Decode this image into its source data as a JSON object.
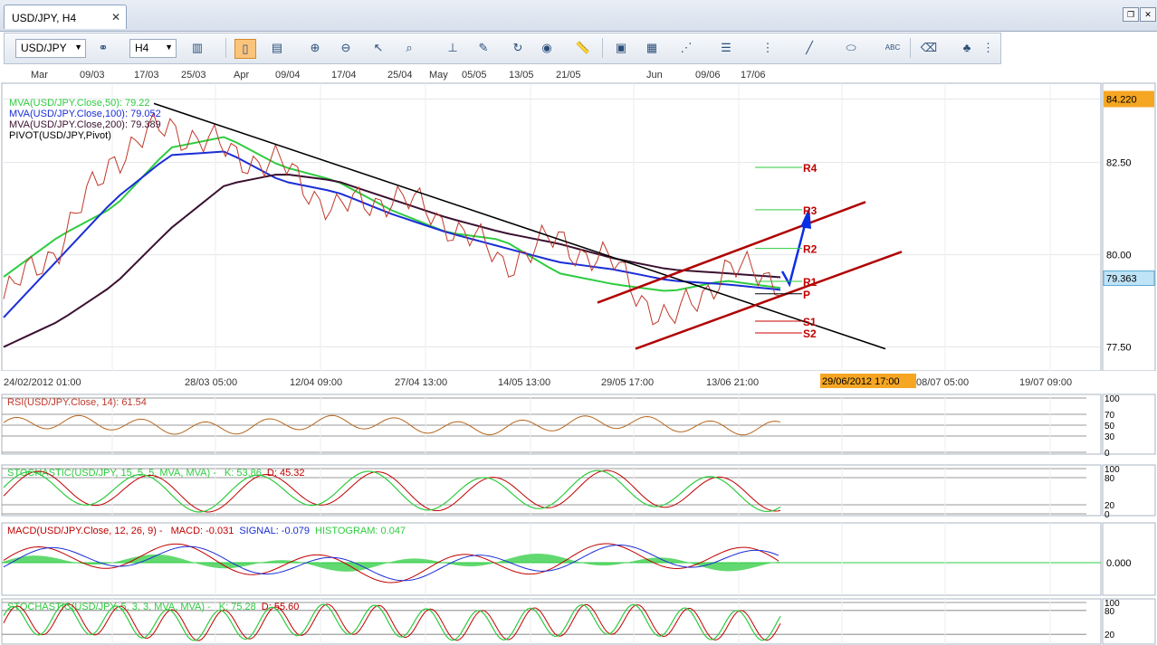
{
  "tab": {
    "title": "USD/JPY, H4",
    "close": "✕"
  },
  "window_controls": [
    "restore-icon",
    "close-icon"
  ],
  "toolbar": {
    "symbol": "USD/JPY",
    "timeframe": "H4",
    "icons": [
      "link-icon",
      "bar-chart-icon",
      "candlestick-icon",
      "line-chart-icon",
      "zoom-in-icon",
      "zoom-out-icon",
      "cursor-icon",
      "zoom-range-icon",
      "crosshair-icon",
      "pencil-chart-icon",
      "refresh-icon",
      "globe-icon",
      "ruler-icon",
      "screenshot-icon",
      "template-icon",
      "trendlines-icon",
      "horizontal-lines-icon",
      "fan-icon",
      "line-draw-icon",
      "ellipse-icon",
      "text-abc-icon",
      "eraser-icon",
      "objects-tree-icon",
      "more-icon"
    ]
  },
  "chart_data": [
    {
      "type": "line",
      "title": "USD/JPY, H4",
      "date_marks": [
        "Mar",
        "09/03",
        "17/03",
        "25/03",
        "Apr",
        "09/04",
        "17/04",
        "25/04",
        "May",
        "05/05",
        "13/05",
        "21/05",
        "Jun",
        "09/06",
        "17/06"
      ],
      "x_ticks": [
        "24/02/2012 01:00",
        "28/03 05:00",
        "12/04 09:00",
        "27/04 13:00",
        "14/05 13:00",
        "29/05 17:00",
        "13/06 21:00",
        "08/07 05:00",
        "19/07 09:00"
      ],
      "cursor_label": "29/06/2012 17:00",
      "y_ticks": [
        84.22,
        82.5,
        80.0,
        77.5
      ],
      "y_tick_labels": [
        "84.220",
        "82.50",
        "80.00",
        "77.50"
      ],
      "ylim": [
        76.9,
        84.6
      ],
      "price_label": "79.363",
      "legend": [
        {
          "text": "MVA(USD/JPY.Close,50): 79.22",
          "color": "#2ecc40"
        },
        {
          "text": "MVA(USD/JPY.Close,100): 79.052",
          "color": "#1a2ed6"
        },
        {
          "text": "MVA(USD/JPY.Close,200): 79.389",
          "color": "#3a1030"
        },
        {
          "text": "PIVOT(USD/JPY,Pivot)",
          "color": "#000000"
        }
      ],
      "pivots": [
        {
          "name": "R4",
          "value": 82.37
        },
        {
          "name": "R3",
          "value": 81.22
        },
        {
          "name": "R2",
          "value": 80.17
        },
        {
          "name": "R1",
          "value": 79.28
        },
        {
          "name": "P",
          "value": 78.94
        },
        {
          "name": "S1",
          "value": 78.2
        },
        {
          "name": "S2",
          "value": 77.88
        }
      ],
      "series": [
        {
          "name": "MVA(USD/JPY.Close,50)",
          "values": [
            79.4,
            80.5,
            81.3,
            82.9,
            83.2,
            82.4,
            82.0,
            81.2,
            80.6,
            80.4,
            79.5,
            79.2,
            79.0,
            79.3,
            79.1
          ]
        },
        {
          "name": "MVA(USD/JPY.Close,100)",
          "values": [
            78.3,
            79.9,
            81.5,
            82.7,
            82.8,
            82.0,
            81.7,
            81.1,
            80.6,
            80.2,
            79.8,
            79.6,
            79.3,
            79.2,
            79.05
          ]
        },
        {
          "name": "MVA(USD/JPY.Close,200)",
          "values": [
            77.5,
            78.2,
            79.2,
            80.7,
            81.9,
            82.2,
            82.0,
            81.5,
            81.0,
            80.6,
            80.3,
            79.9,
            79.6,
            79.5,
            79.39
          ]
        },
        {
          "name": "close",
          "values": [
            78.8,
            80.3,
            82.7,
            83.5,
            82.8,
            82.4,
            81.2,
            81.6,
            80.9,
            79.8,
            80.4,
            79.7,
            78.1,
            79.6,
            79.36
          ]
        }
      ]
    },
    {
      "type": "line",
      "title": "RSI(USD/JPY.Close, 14): 61.54",
      "y_tick_labels": [
        "100",
        "70",
        "50",
        "30",
        "0"
      ],
      "ylim": [
        0,
        100
      ]
    },
    {
      "type": "line",
      "title_parts": [
        "STOCHASTIC(USD/JPY, 15, 5, 5, MVA, MVA) - ",
        "K: 53.86",
        "D: 45.32"
      ],
      "y_tick_labels": [
        "100",
        "80",
        "20",
        "0"
      ],
      "ylim": [
        0,
        100
      ]
    },
    {
      "type": "bar",
      "title_parts": [
        "MACD(USD/JPY.Close, 12, 26, 9) - ",
        "MACD: -0.031",
        "SIGNAL: -0.079",
        "HISTOGRAM: 0.047"
      ],
      "y_tick_labels": [
        "0.000"
      ]
    },
    {
      "type": "line",
      "title_parts": [
        "STOCHASTIC(USD/JPY, 5, 3, 3, MVA, MVA) - ",
        "K: 75.28",
        "D: 55.60"
      ],
      "y_tick_labels": [
        "100",
        "80",
        "20"
      ],
      "ylim": [
        0,
        100
      ]
    }
  ]
}
